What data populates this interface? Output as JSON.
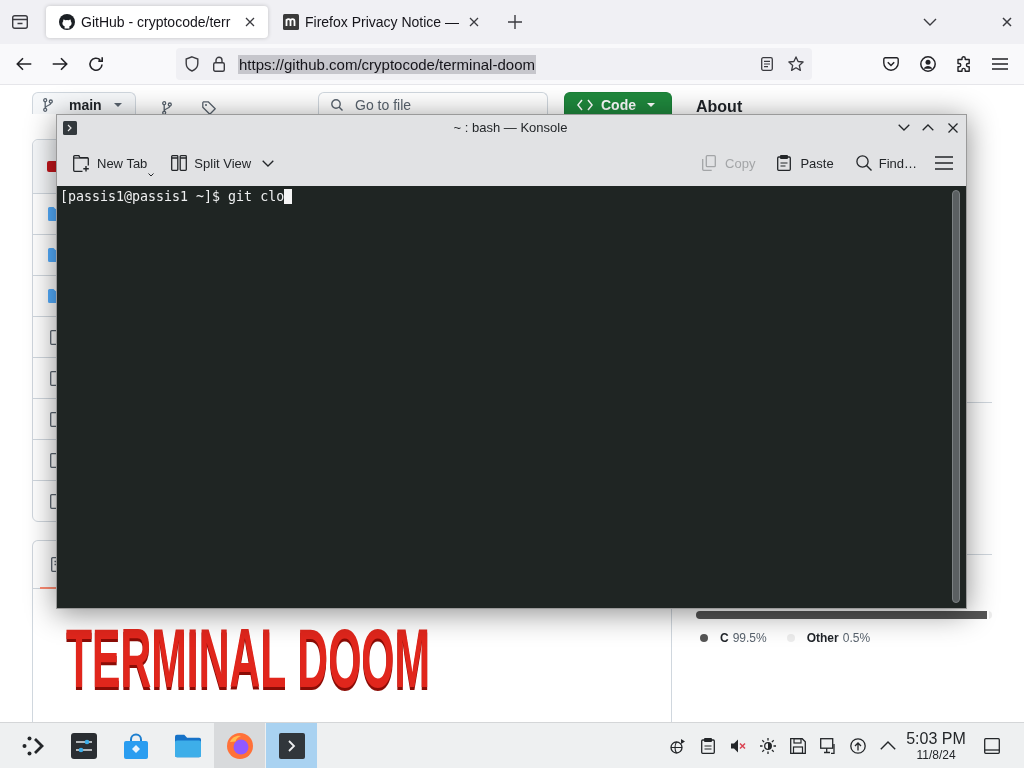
{
  "browser": {
    "tabs": [
      {
        "title": "GitHub - cryptocode/terr",
        "selected": true
      },
      {
        "title": "Firefox Privacy Notice —",
        "selected": false
      }
    ],
    "address_bar": {
      "url": "https://github.com/cryptocode/terminal-doom",
      "text_selected": true
    }
  },
  "github": {
    "branch_button": "main",
    "file_search": {
      "placeholder": "Go to file"
    },
    "code_button": "Code",
    "about_heading": "About",
    "file_rows": [
      {
        "kind": "commit"
      },
      {
        "kind": "folder"
      },
      {
        "kind": "folder"
      },
      {
        "kind": "folder"
      },
      {
        "kind": "file"
      },
      {
        "kind": "file"
      },
      {
        "kind": "file"
      },
      {
        "kind": "file"
      },
      {
        "kind": "file"
      }
    ],
    "readme_logo": "TERMINAL DOOM",
    "languages": [
      {
        "name": "C",
        "percent": "99.5%",
        "color": "#555555",
        "level": 0.995
      },
      {
        "name": "Other",
        "percent": "0.5%",
        "color": "#ededed"
      }
    ]
  },
  "konsole": {
    "title": "~ : bash — Konsole",
    "toolbar_left": [
      {
        "label": "New Tab",
        "disabled": false
      },
      {
        "label": "Split View",
        "disabled": false
      }
    ],
    "toolbar_right": [
      {
        "label": "Copy",
        "disabled": true
      },
      {
        "label": "Paste",
        "disabled": false
      },
      {
        "label": "Find…",
        "disabled": false
      }
    ],
    "terminal_line": "[passis1@passis1 ~]$ git clo"
  },
  "taskbar": {
    "tasks": [
      {
        "running": false,
        "selected": false
      },
      {
        "running": false,
        "selected": false
      },
      {
        "running": false,
        "selected": false
      },
      {
        "running": true,
        "selected": false
      },
      {
        "running": true,
        "selected": true
      }
    ],
    "clock": {
      "time": "5:03 PM",
      "date": "11/8/24"
    }
  }
}
